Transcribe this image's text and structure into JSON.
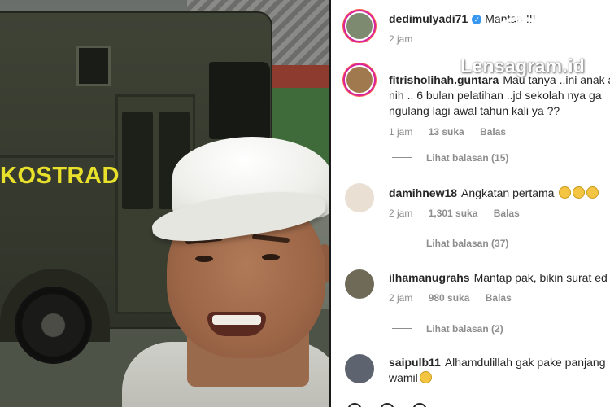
{
  "video": {
    "truck_label": "KOSTRAD"
  },
  "comments": [
    {
      "username": "dedimulyadi71",
      "verified": true,
      "text": "Mantap !!!",
      "time": "2 jam",
      "likes": "",
      "reply_label": "",
      "avatar_icon": "profile-photo-icon"
    },
    {
      "username": "fitrisholihah.guntara",
      "verified": false,
      "text": "Mau tanya ..ini anak a",
      "text_line2": "nih .. 6 bulan pelatihan ..jd sekolah nya ga",
      "text_line3": "ngulang lagi awal tahun kali ya ??",
      "time": "1 jam",
      "likes": "13 suka",
      "reply_label": "Balas",
      "view_replies": "Lihat balasan (15)",
      "avatar_icon": "profile-photo-icon"
    },
    {
      "username": "damihnew18",
      "verified": false,
      "text": "Angkatan pertama",
      "emoji_count": 3,
      "time": "2 jam",
      "likes": "1,301 suka",
      "reply_label": "Balas",
      "view_replies": "Lihat balasan (37)",
      "avatar_icon": "profile-photo-icon"
    },
    {
      "username": "ilhamanugrahs",
      "verified": false,
      "text": "Mantap pak, bikin surat ed",
      "time": "2 jam",
      "likes": "980 suka",
      "reply_label": "Balas",
      "view_replies": "Lihat balasan (2)",
      "avatar_icon": "profile-photo-icon"
    },
    {
      "username": "saipulb11",
      "verified": false,
      "text": "Alhamdulillah gak pake panjang",
      "text_line2": "wamil",
      "time": "",
      "likes": "",
      "reply_label": "",
      "avatar_icon": "profile-photo-icon"
    }
  ],
  "watermark": {
    "text": "Lensagram.id"
  },
  "colors": {
    "text": "#262626",
    "meta": "#8e8e8e",
    "verified": "#3897f0",
    "truck_label": "#e8e02a"
  }
}
